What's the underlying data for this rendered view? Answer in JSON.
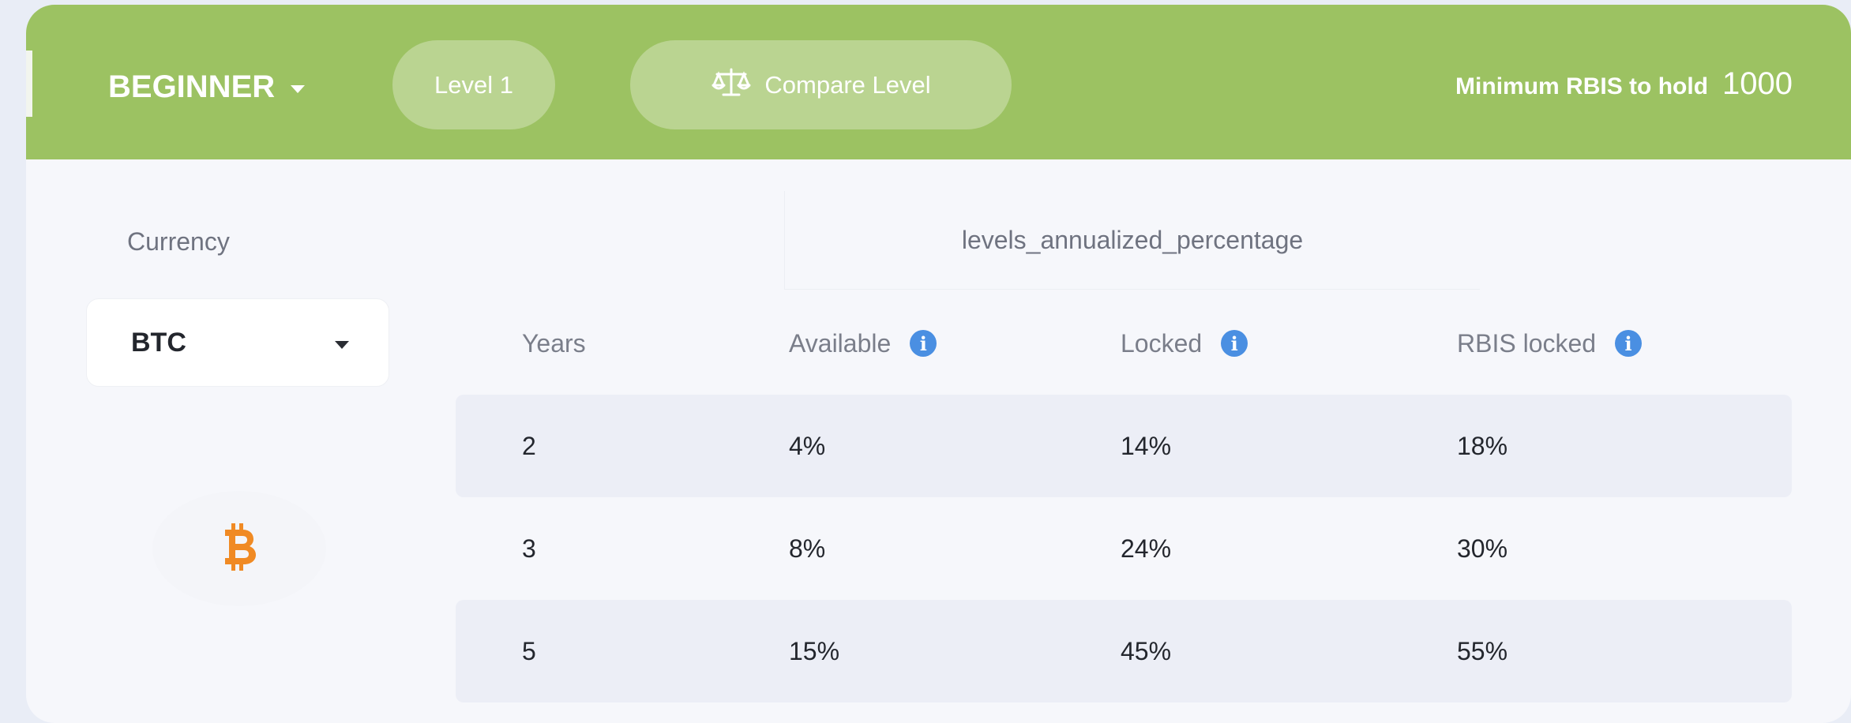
{
  "header": {
    "level_name": "BEGINNER",
    "level_pill": "Level 1",
    "compare_label": "Compare Level",
    "min_hold_label": "Minimum RBIS to hold",
    "min_hold_value": "1000"
  },
  "currency": {
    "label": "Currency",
    "selected": "BTC",
    "icon": "bitcoin-icon",
    "icon_color": "#f08a24"
  },
  "table": {
    "title": "levels_annualized_percentage",
    "headers": [
      "Years",
      "Available",
      "Locked",
      "RBIS locked"
    ],
    "info_icon_color": "#4a8fe2",
    "rows": [
      [
        "2",
        "4%",
        "14%",
        "18%"
      ],
      [
        "3",
        "8%",
        "24%",
        "30%"
      ],
      [
        "5",
        "15%",
        "45%",
        "55%"
      ]
    ]
  },
  "colors": {
    "header_green": "#9cc262",
    "card_bg": "#f6f7fb",
    "row_shade": "#eceef6"
  }
}
